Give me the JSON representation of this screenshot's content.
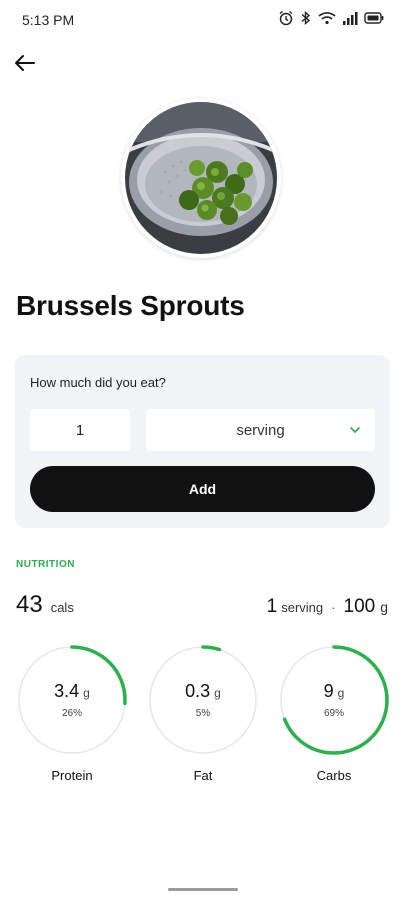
{
  "status_bar": {
    "time": "5:13 PM"
  },
  "food": {
    "name": "Brussels Sprouts"
  },
  "portion": {
    "question": "How much did you eat?",
    "quantity": "1",
    "unit": "serving",
    "add_label": "Add"
  },
  "nutrition": {
    "section_label": "NUTRITION",
    "calories": "43",
    "calories_unit": "cals",
    "serving_qty": "1",
    "serving_unit": "serving",
    "separator": "·",
    "weight": "100",
    "weight_unit": "g"
  },
  "macros": [
    {
      "name": "Protein",
      "value": "3.4",
      "unit": "g",
      "percent_label": "26%",
      "percent": 26
    },
    {
      "name": "Fat",
      "value": "0.3",
      "unit": "g",
      "percent_label": "5%",
      "percent": 5
    },
    {
      "name": "Carbs",
      "value": "9",
      "unit": "g",
      "percent_label": "69%",
      "percent": 69
    }
  ],
  "colors": {
    "accent_green": "#2bb04a",
    "ring_track": "#e6e6e6",
    "button_dark": "#111111",
    "card_bg": "#f1f3f6"
  },
  "icons": {
    "back": "arrow-left-icon",
    "dropdown": "chevron-down-icon",
    "alarm": "alarm-icon",
    "bluetooth": "bluetooth-icon",
    "wifi": "wifi-icon",
    "signal": "signal-icon",
    "battery": "battery-icon"
  }
}
